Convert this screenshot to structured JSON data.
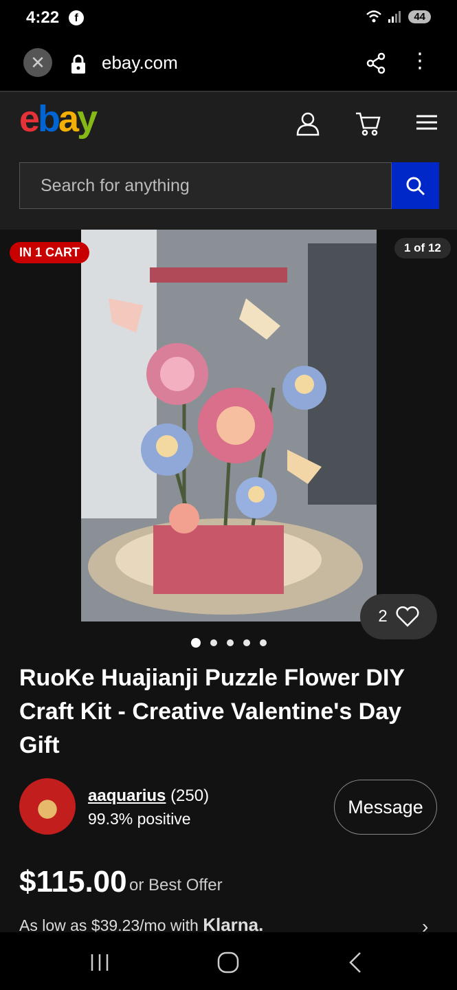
{
  "status_bar": {
    "time": "4:22",
    "battery": "44"
  },
  "browser": {
    "url": "ebay.com",
    "close_symbol": "✕",
    "menu_symbol": "⋮"
  },
  "header": {
    "logo": {
      "e": "e",
      "b": "b",
      "a": "a",
      "y": "y"
    }
  },
  "search": {
    "placeholder": "Search for anything"
  },
  "gallery": {
    "cart_badge": "IN 1 CART",
    "image_count": "1 of 12",
    "watch_count": "2",
    "dots": 5,
    "active_dot": 0
  },
  "item": {
    "title": "RuoKe Huajianji Puzzle Flower DIY Craft Kit - Creative Valentine's Day Gift"
  },
  "seller": {
    "name": "aaquarius",
    "rating_count": "(250)",
    "feedback": "99.3% positive",
    "message_label": "Message"
  },
  "pricing": {
    "price": "$115.00",
    "best_offer": "or Best Offer",
    "klarna_text": "As low as $39.23/mo with",
    "klarna_brand": "Klarna."
  },
  "colors": {
    "accent_blue": "#0028c8",
    "badge_red": "#c80000",
    "logo_e": "#e53238",
    "logo_b": "#0064d2",
    "logo_a": "#f5af02",
    "logo_y": "#86b817"
  }
}
